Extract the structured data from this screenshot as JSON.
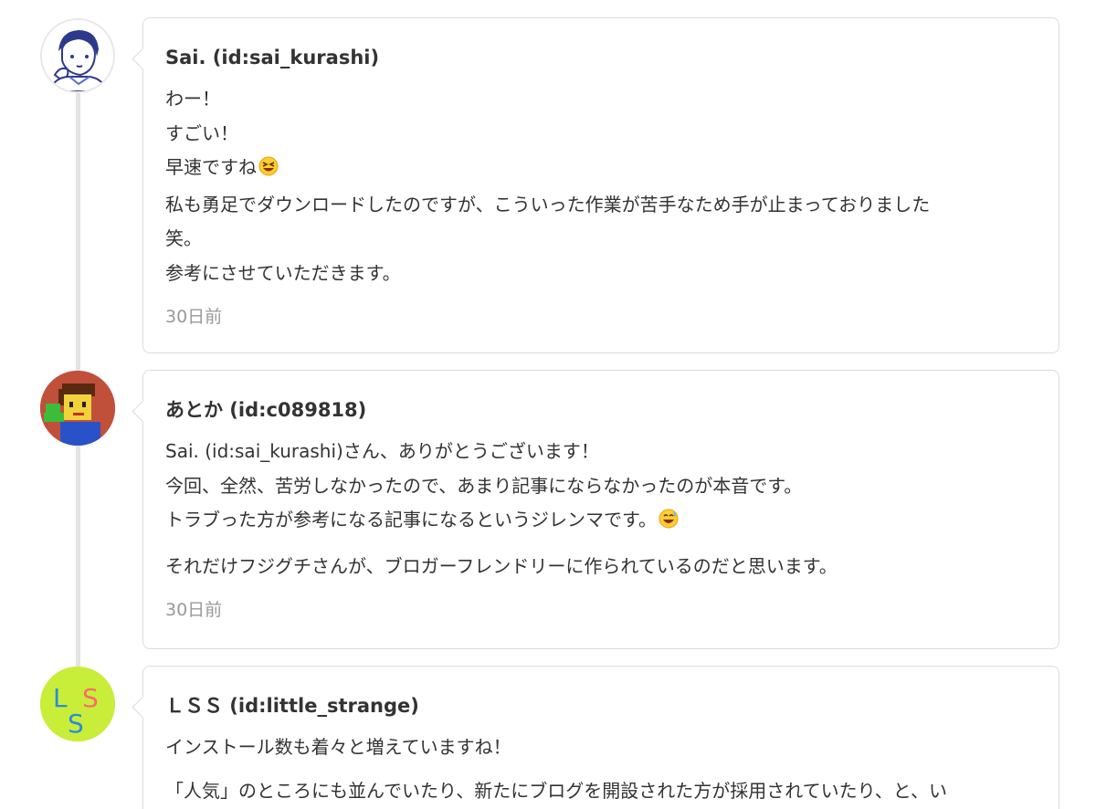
{
  "comments": [
    {
      "author": "Sai. (id:sai_kurashi)",
      "lines": [
        "わー！",
        "すごい！",
        "早速ですね",
        "私も勇足でダウンロードしたのですが、こういった作業が苦手なため手が止まっておりました",
        "笑。",
        "参考にさせていただきます。"
      ],
      "timestamp": "30日前",
      "avatar_icon": "avatar-person-thinking-icon"
    },
    {
      "author": "あとか (id:c089818)",
      "lines": [
        "Sai. (id:sai_kurashi)さん、ありがとうございます！",
        "今回、全然、苦労しなかったので、あまり記事にならなかったのが本音です。",
        "トラブった方が参考になる記事になるというジレンマです。"
      ],
      "second_paragraph": "それだけフジグチさんが、ブロガーフレンドリーに作られているのだと思います。",
      "timestamp": "30日前",
      "avatar_icon": "avatar-pixel-character-icon"
    },
    {
      "author": "ＬＳＳ (id:little_strange)",
      "lines": [
        "インストール数も着々と増えていますね！"
      ],
      "second_paragraph": "「人気」のところにも並んでいたり、新たにブログを開設された方が採用されていたり、と、い",
      "avatar_icon": "avatar-lss-logo-icon"
    }
  ],
  "colors": {
    "timeline": "#e4e4e4",
    "card_border": "#dcdcdc",
    "text": "#333333",
    "muted": "#999999",
    "lss_bg": "#c8ee3a"
  }
}
